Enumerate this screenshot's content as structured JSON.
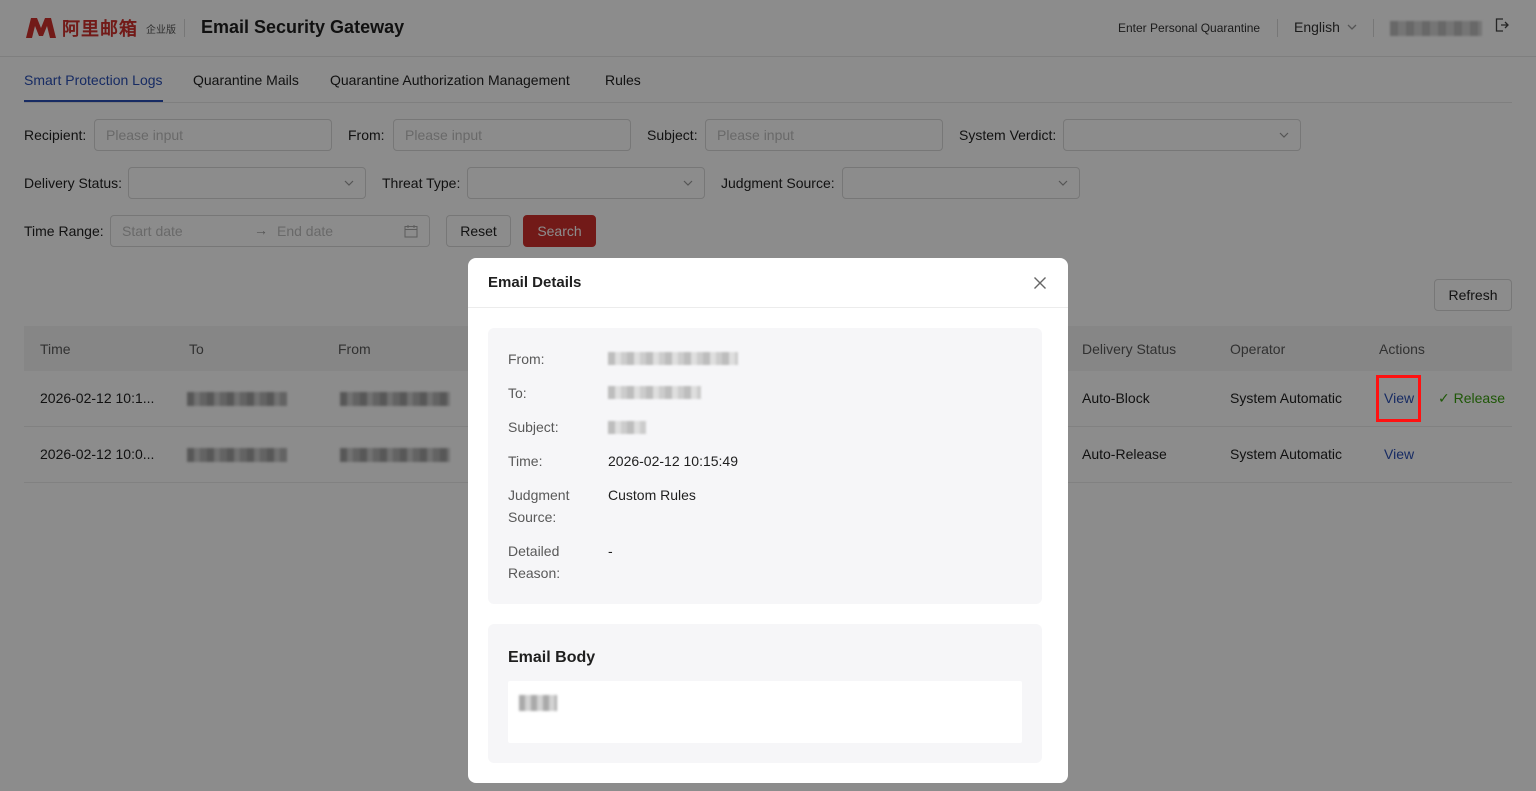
{
  "header": {
    "logo_text": "阿里邮箱",
    "edition": "企业版",
    "title": "Email Security Gateway",
    "personal_quarantine": "Enter Personal Quarantine",
    "language": "English"
  },
  "tabs": [
    {
      "label": "Smart Protection Logs",
      "active": true
    },
    {
      "label": "Quarantine Mails",
      "active": false
    },
    {
      "label": "Quarantine Authorization Management",
      "active": false
    },
    {
      "label": "Rules",
      "active": false
    }
  ],
  "filters": {
    "recipient_label": "Recipient",
    "from_label": "From",
    "subject_label": "Subject",
    "verdict_label": "System Verdict",
    "delivery_label": "Delivery Status",
    "threat_label": "Threat Type",
    "judgment_label": "Judgment Source",
    "time_label": "Time Range",
    "placeholder": "Please input",
    "start_date": "Start date",
    "end_date": "End date",
    "reset": "Reset",
    "search": "Search",
    "refresh": "Refresh"
  },
  "table": {
    "columns": [
      "Time",
      "To",
      "From",
      "Delivery Status",
      "Operator",
      "Actions"
    ],
    "rows": [
      {
        "time": "2026-02-12 10:1...",
        "delivery": "Auto-Block",
        "operator": "System Automatic",
        "view": "View",
        "release": "Release"
      },
      {
        "time": "2026-02-12 10:0...",
        "delivery": "Auto-Release",
        "operator": "System Automatic",
        "view": "View"
      }
    ]
  },
  "modal": {
    "title": "Email Details",
    "from_label": "From:",
    "to_label": "To:",
    "subject_label": "Subject:",
    "time_label": "Time:",
    "time_value": "2026-02-12 10:15:49",
    "judgment_label": "Judgment Source:",
    "judgment_value": "Custom Rules",
    "reason_label": "Detailed Reason:",
    "reason_value": "-",
    "body_title": "Email Body"
  },
  "colors": {
    "brand_red": "#d0312d",
    "link_blue": "#2a4fb5",
    "release_green": "#389e0d",
    "highlight": "#ff1111"
  }
}
